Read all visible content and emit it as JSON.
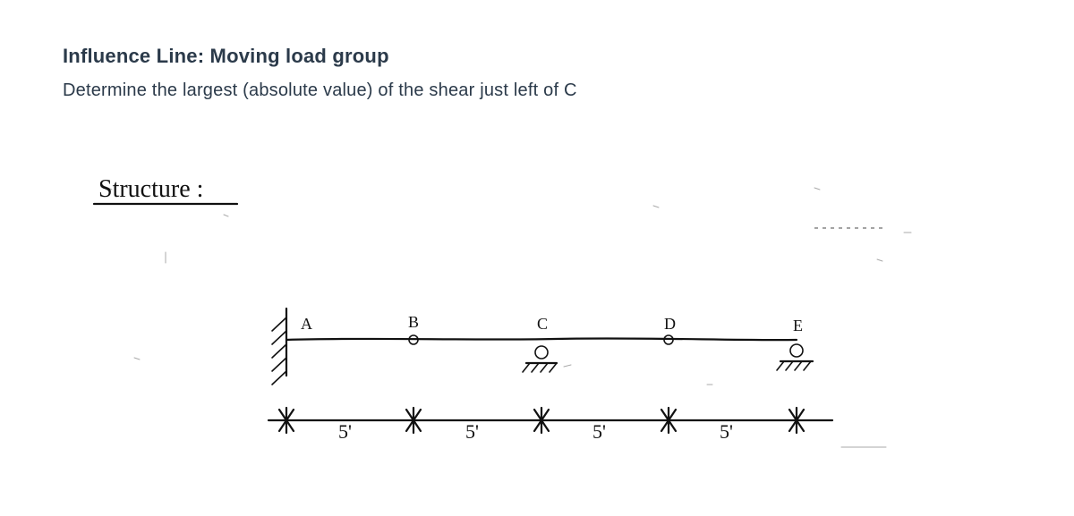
{
  "title": "Influence Line: Moving load group",
  "prompt": "Determine the largest (absolute value) of the shear just left of C",
  "heading": "Structure :",
  "points": {
    "A": "A",
    "B": "B",
    "C": "C",
    "D": "D",
    "E": "E"
  },
  "spans": {
    "s1": "5'",
    "s2": "5'",
    "s3": "5'",
    "s4": "5'"
  }
}
